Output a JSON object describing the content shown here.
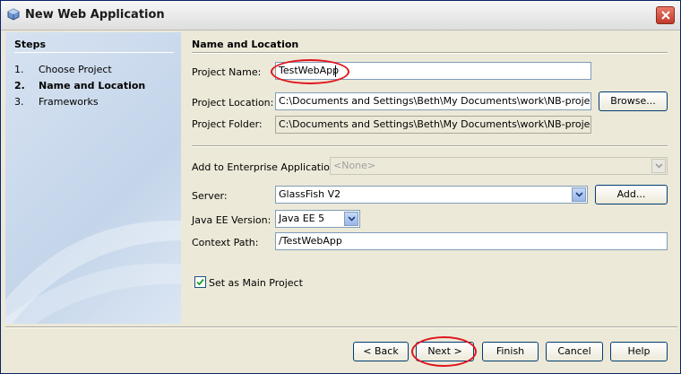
{
  "window": {
    "title": "New Web Application"
  },
  "steps": {
    "heading": "Steps",
    "items": [
      {
        "num": "1.",
        "label": "Choose Project",
        "current": false
      },
      {
        "num": "2.",
        "label": "Name and Location",
        "current": true
      },
      {
        "num": "3.",
        "label": "Frameworks",
        "current": false
      }
    ]
  },
  "form": {
    "heading": "Name and Location",
    "project_name": {
      "label": "Project Name:",
      "value": "TestWebApp"
    },
    "project_location": {
      "label": "Project Location:",
      "value": "C:\\Documents and Settings\\Beth\\My Documents\\work\\NB-projects"
    },
    "project_folder": {
      "label": "Project Folder:",
      "value": "C:\\Documents and Settings\\Beth\\My Documents\\work\\NB-projects\\TestWebApp"
    },
    "browse_label": "Browse...",
    "enterprise_app": {
      "label": "Add to Enterprise Application:",
      "value": "<None>"
    },
    "server": {
      "label": "Server:",
      "value": "GlassFish V2"
    },
    "add_label": "Add...",
    "java_ee": {
      "label": "Java EE Version:",
      "value": "Java EE 5"
    },
    "context_path": {
      "label": "Context Path:",
      "value": "/TestWebApp"
    },
    "main_project": {
      "label": "Set as Main Project",
      "checked": true
    }
  },
  "buttons": {
    "back": "< Back",
    "next": "Next >",
    "finish": "Finish",
    "cancel": "Cancel",
    "help": "Help"
  },
  "colors": {
    "highlight": "#e0151c",
    "field_border": "#7f9db9",
    "dialog_bg": "#ece9d8"
  }
}
